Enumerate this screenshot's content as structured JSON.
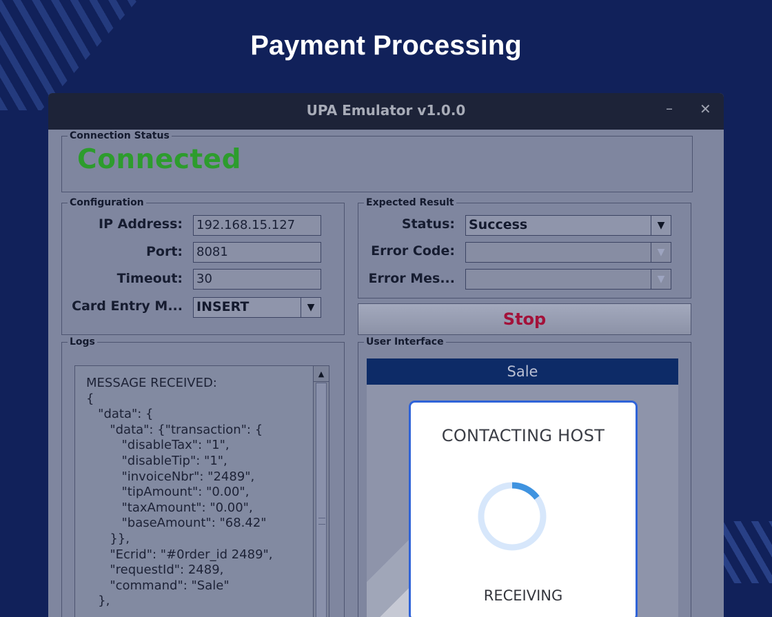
{
  "page": {
    "title": "Payment Processing"
  },
  "window": {
    "title": "UPA Emulator v1.0.0",
    "minimize_glyph": "–",
    "close_glyph": "✕"
  },
  "connection": {
    "group_label": "Connection Status",
    "status": "Connected",
    "status_color": "#2d9c2d"
  },
  "configuration": {
    "group_label": "Configuration",
    "ip_label": "IP Address:",
    "ip_value": "192.168.15.127",
    "port_label": "Port:",
    "port_value": "8081",
    "timeout_label": "Timeout:",
    "timeout_value": "30",
    "card_entry_label": "Card Entry M...",
    "card_entry_value": "INSERT"
  },
  "expected_result": {
    "group_label": "Expected Result",
    "status_label": "Status:",
    "status_value": "Success",
    "error_code_label": "Error Code:",
    "error_code_value": "",
    "error_message_label": "Error Mes...",
    "error_message_value": ""
  },
  "stop_button": {
    "label": "Stop",
    "color": "#a3123a"
  },
  "logs": {
    "group_label": "Logs",
    "text": "MESSAGE RECEIVED:\n{\n   \"data\": {\n      \"data\": {\"transaction\": {\n         \"disableTax\": \"1\",\n         \"disableTip\": \"1\",\n         \"invoiceNbr\": \"2489\",\n         \"tipAmount\": \"0.00\",\n         \"taxAmount\": \"0.00\",\n         \"baseAmount\": \"68.42\"\n      }},\n      \"Ecrid\": \"#0rder_id 2489\",\n      \"requestId\": 2489,\n      \"command\": \"Sale\"\n   },"
  },
  "user_interface": {
    "group_label": "User Interface",
    "header": "Sale",
    "dialog_title": "CONTACTING HOST",
    "dialog_status": "RECEIVING",
    "accent_color": "#2f63d8"
  },
  "icons": {
    "dropdown": "chevron-down-icon",
    "scroll_up": "arrow-up-icon",
    "spinner": "loading-spinner-icon"
  }
}
